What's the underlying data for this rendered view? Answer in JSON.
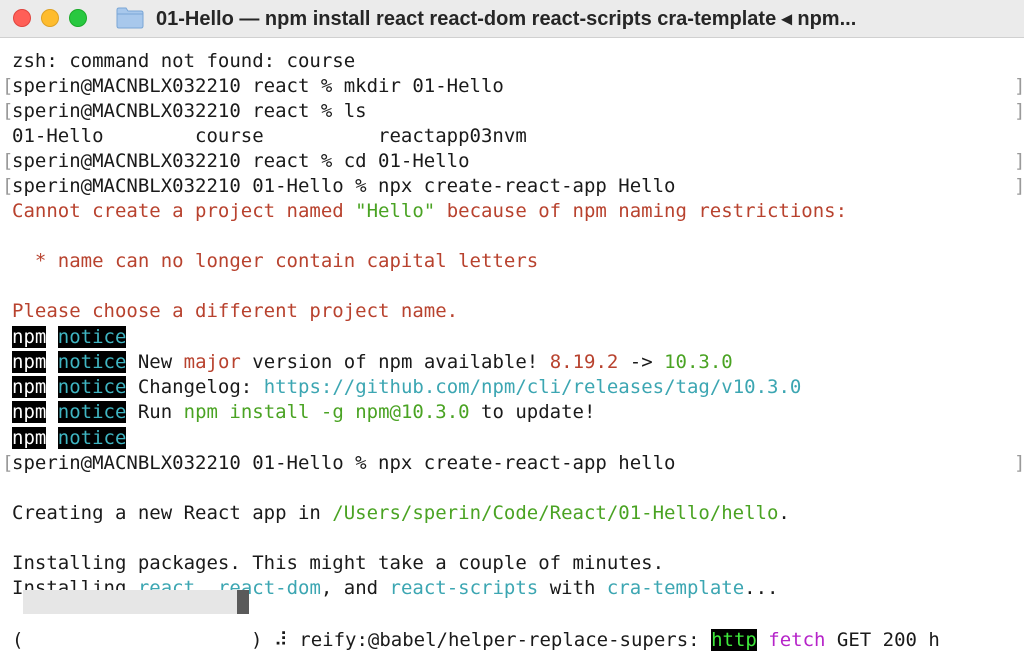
{
  "window": {
    "title": "01-Hello — npm install react react-dom react-scripts cra-template ◂ npm...",
    "folder_icon": "folder-icon"
  },
  "terminal": {
    "l1": "zsh: command not found: course",
    "l2": "sperin@MACNBLX032210 react % mkdir 01-Hello",
    "l3": "sperin@MACNBLX032210 react % ls",
    "l4": "01-Hello        course          reactapp03nvm",
    "l5": "sperin@MACNBLX032210 react % cd 01-Hello",
    "l6": "sperin@MACNBLX032210 01-Hello % npx create-react-app Hello",
    "l7": {
      "a": "Cannot create a project named ",
      "b": "\"Hello\"",
      "c": " because of npm naming restrictions:"
    },
    "l9": "  * name can no longer contain capital letters",
    "l11": "Please choose a different project name.",
    "npm": "npm",
    "notice": "notice",
    "n2": {
      "a": " New ",
      "b": "major",
      "c": " version of npm available! ",
      "d": "8.19.2",
      "e": " -> ",
      "f": "10.3.0"
    },
    "n3": {
      "a": " Changelog: ",
      "b": "https://github.com/npm/cli/releases/tag/v10.3.0"
    },
    "n4": {
      "a": " Run ",
      "b": "npm install -g npm@10.3.0",
      "c": " to update!"
    },
    "l17": "sperin@MACNBLX032210 01-Hello % npx create-react-app hello",
    "l19": {
      "a": "Creating a new React app in ",
      "b": "/Users/sperin/Code/React/01-Hello/hello",
      "c": "."
    },
    "l21": "Installing packages. This might take a couple of minutes.",
    "l22": {
      "a": "Installing ",
      "b": "react",
      "c": ", ",
      "d": "react-dom",
      "e": ", and ",
      "f": "react-scripts",
      "g": " with ",
      "h": "cra-template",
      "i": "..."
    },
    "l24": {
      "open": "(",
      "close": ")",
      "spinner": " ⠼ ",
      "msg": "reify:@babel/helper-replace-supers: ",
      "http": "http",
      "fetch": "fetch",
      "rest": " GET 200 h"
    },
    "bracket_left": "[",
    "bracket_right": "]"
  }
}
